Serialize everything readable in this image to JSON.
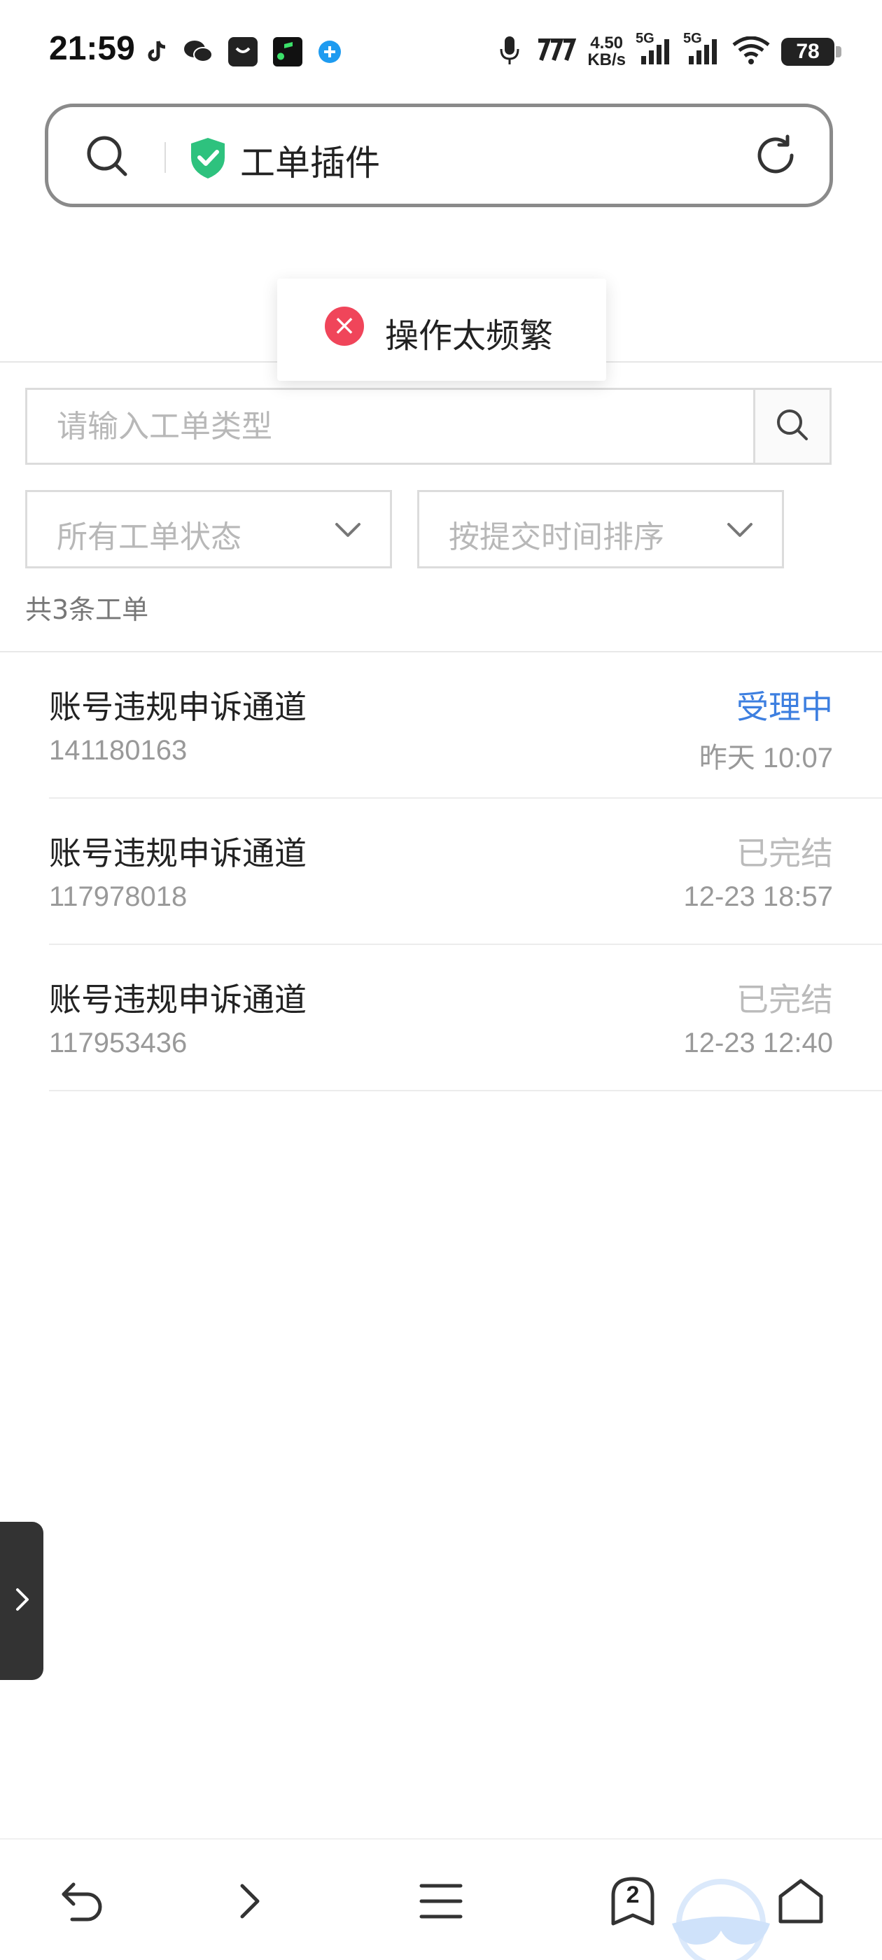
{
  "status_bar": {
    "time": "21:59",
    "net_speed_value": "4.50",
    "net_speed_unit": "KB/s",
    "signal_1_label": "5G",
    "signal_2_label": "5G",
    "battery": "78",
    "icons": [
      "tiktok-icon",
      "wechat-icon",
      "bag-app-icon",
      "music-app-icon",
      "plus-app-icon",
      "mic-icon",
      "signal-icon",
      "wifi-icon"
    ]
  },
  "address_bar": {
    "title": "工单插件"
  },
  "toast": {
    "message": "操作太频繁"
  },
  "search": {
    "placeholder": "请输入工单类型",
    "value": ""
  },
  "filters": {
    "status_label": "所有工单状态",
    "sort_label": "按提交时间排序"
  },
  "count_text": "共3条工单",
  "tickets": [
    {
      "title": "账号违规申诉通道",
      "id": "141180163",
      "status": "受理中",
      "date": "昨天 10:07"
    },
    {
      "title": "账号违规申诉通道",
      "id": "117978018",
      "status": "已完结",
      "date": "12-23 18:57"
    },
    {
      "title": "账号违规申诉通道",
      "id": "117953436",
      "status": "已完结",
      "date": "12-23 12:40"
    }
  ],
  "bottom_nav": {
    "tab_count": "2"
  },
  "colors": {
    "accent_blue": "#3d7fe0",
    "error_red": "#f0455a",
    "shield_green": "#2ec27e"
  }
}
